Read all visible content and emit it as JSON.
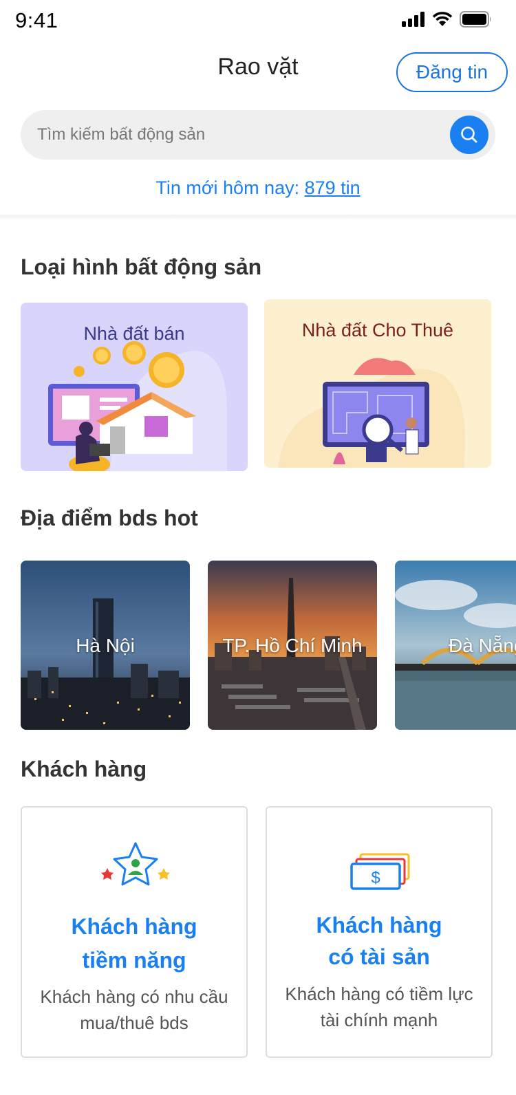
{
  "status": {
    "time": "9:41"
  },
  "header": {
    "title": "Rao vặt",
    "post_label": "Đăng tin"
  },
  "search": {
    "placeholder": "Tìm kiếm bất động sản"
  },
  "new_today": {
    "prefix": "Tin mới hôm nay: ",
    "count": "879 tin"
  },
  "property_types": {
    "title": "Loại hình bất động sản",
    "items": [
      {
        "label": "Nhà đất bán",
        "bg": "#d8d4fb",
        "label_color": "#3b3a8c"
      },
      {
        "label": "Nhà đất Cho Thuê",
        "bg": "#fdf0cf",
        "label_color": "#7a1f1f"
      }
    ]
  },
  "hot_locations": {
    "title": "Địa điểm bds hot",
    "items": [
      {
        "label": "Hà Nội"
      },
      {
        "label": "TP. Hồ Chí Minh"
      },
      {
        "label": "Đà Nẵng"
      }
    ]
  },
  "customers": {
    "title": "Khách hàng",
    "items": [
      {
        "title_line1": "Khách hàng",
        "title_line2": "tiềm năng",
        "desc_line1": "Khách hàng có nhu cầu",
        "desc_line2": "mua/thuê bds",
        "icon": "star-user-icon"
      },
      {
        "title_line1": "Khách hàng",
        "title_line2": "có tài sản",
        "desc_line1": "Khách hàng có tiềm lực",
        "desc_line2": "tài chính mạnh",
        "icon": "money-stack-icon"
      }
    ]
  },
  "colors": {
    "accent": "#1a7ff0"
  }
}
